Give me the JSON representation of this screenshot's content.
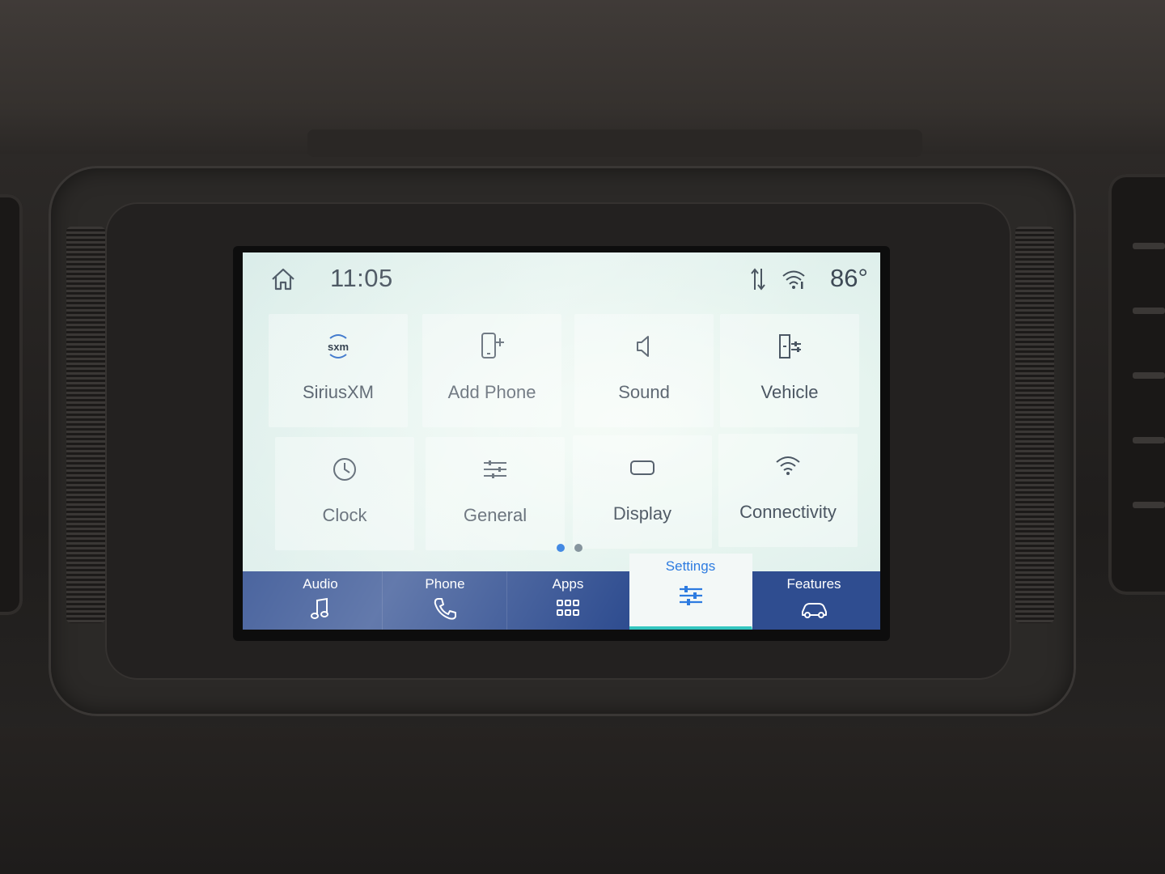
{
  "status_bar": {
    "time": "11:05",
    "temperature": "86°",
    "icons": [
      "home-icon",
      "signal-arrows-icon",
      "wifi-icon"
    ]
  },
  "settings_tiles": [
    {
      "label": "SiriusXM",
      "icon": "siriusxm-icon"
    },
    {
      "label": "Add Phone",
      "icon": "add-phone-icon"
    },
    {
      "label": "Sound",
      "icon": "speaker-icon"
    },
    {
      "label": "Vehicle",
      "icon": "vehicle-settings-icon"
    },
    {
      "label": "Clock",
      "icon": "clock-icon"
    },
    {
      "label": "General",
      "icon": "sliders-icon"
    },
    {
      "label": "Display",
      "icon": "display-icon"
    },
    {
      "label": "Connectivity",
      "icon": "wifi-icon"
    }
  ],
  "siriusxm_logo_text": "sxm",
  "pager": {
    "page_count": 2,
    "current_page": 1
  },
  "tabbar": {
    "tabs": [
      {
        "label": "Audio",
        "icon": "music-note-icon",
        "active": false
      },
      {
        "label": "Phone",
        "icon": "phone-icon",
        "active": false
      },
      {
        "label": "Apps",
        "icon": "apps-grid-icon",
        "active": false
      },
      {
        "label": "Settings",
        "icon": "settings-sliders-icon",
        "active": true
      },
      {
        "label": "Features",
        "icon": "car-features-icon",
        "active": false
      }
    ]
  },
  "colors": {
    "tabbar_bg": "#2f4d90",
    "active_tab_text": "#2d7be0",
    "active_tab_underline": "#34c6c0",
    "text": "#4b5662",
    "pager_active": "#2d7be0",
    "pager_inactive": "#7a8a94"
  }
}
